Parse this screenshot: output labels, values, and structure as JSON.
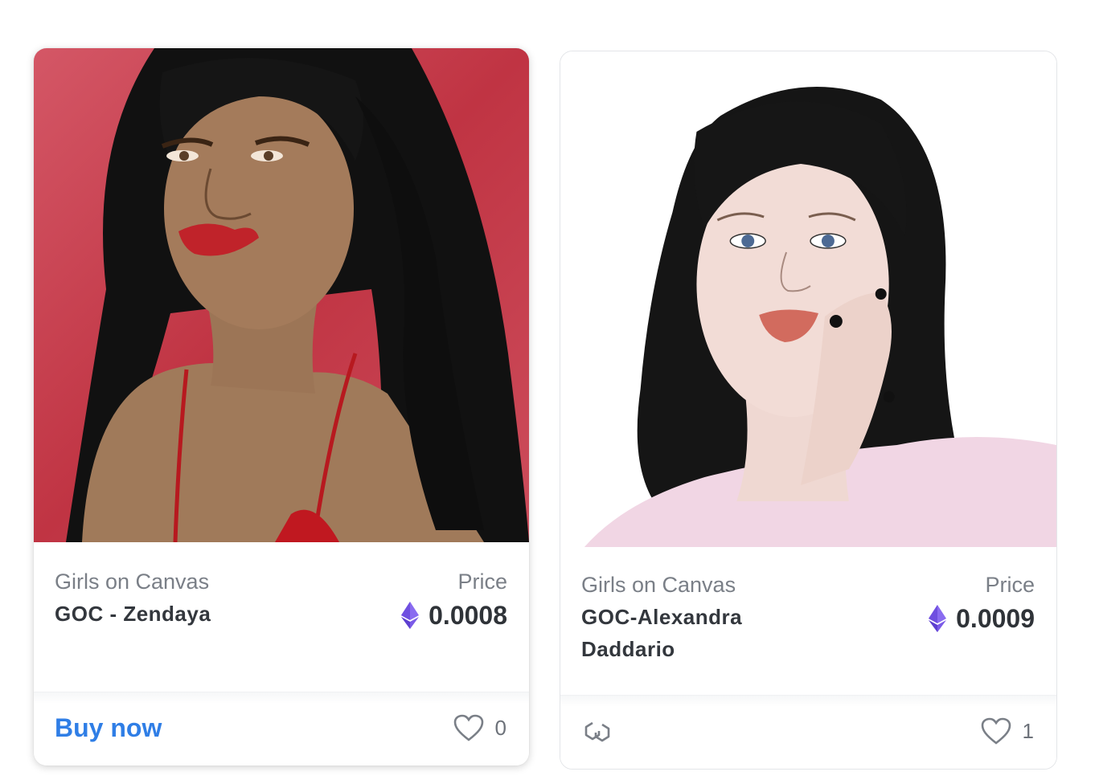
{
  "cards": [
    {
      "collection": "Girls on Canvas",
      "name": "GOC - Zendaya",
      "price_label": "Price",
      "price": "0.0008",
      "action_label": "Buy now",
      "likes": "0",
      "bg_color": "#c8414f",
      "currency_icon": "ethereum-icon",
      "like_icon": "heart-icon"
    },
    {
      "collection": "Girls on Canvas",
      "name": "GOC-Alexandra Daddario",
      "price_label": "Price",
      "price": "0.0009",
      "likes": "1",
      "chain_icon": "polygon-icon",
      "currency_icon": "ethereum-icon",
      "like_icon": "heart-icon"
    }
  ],
  "colors": {
    "accent": "#2f7ee6",
    "eth": "#6f4fe0"
  }
}
